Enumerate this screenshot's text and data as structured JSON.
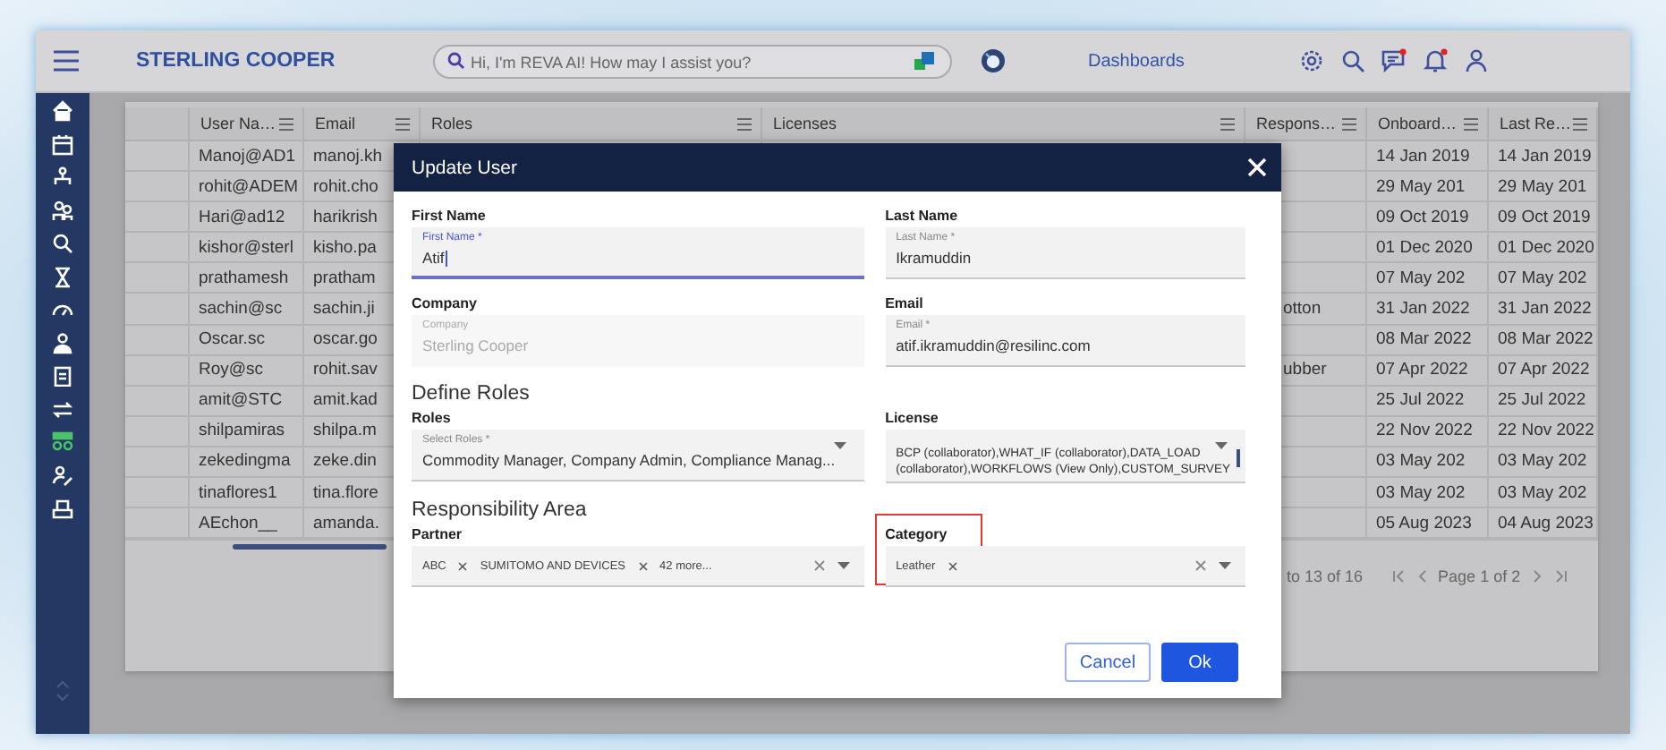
{
  "top_bar": {
    "brand": "STERLING COOPER",
    "search": {
      "placeholder": "Hi, I'm REVA AI! How may I assist you?"
    },
    "nav_link": "Dashboards",
    "icons": [
      {
        "kind": "settings",
        "badge": false
      },
      {
        "kind": "search",
        "badge": false
      },
      {
        "kind": "messages",
        "badge": true
      },
      {
        "kind": "notifications",
        "badge": true
      },
      {
        "kind": "user",
        "badge": false
      }
    ]
  },
  "sidebar": {
    "items": [
      {
        "kind": "home",
        "selected": false
      },
      {
        "kind": "calendar",
        "selected": false
      },
      {
        "kind": "hierarchy",
        "selected": false
      },
      {
        "kind": "group",
        "selected": false
      },
      {
        "kind": "search-person",
        "selected": false
      },
      {
        "kind": "hourglass",
        "selected": false
      },
      {
        "kind": "gauge",
        "selected": false
      },
      {
        "kind": "person",
        "selected": false
      },
      {
        "kind": "clipboard",
        "selected": false
      },
      {
        "kind": "transfer",
        "selected": false
      },
      {
        "kind": "network",
        "selected": true
      },
      {
        "kind": "person-edit",
        "selected": false
      },
      {
        "kind": "tray",
        "selected": false
      }
    ]
  },
  "table": {
    "columns": [
      "User Na…",
      "Email",
      "Roles",
      "Licenses",
      "Respons…",
      "Onboard…",
      "Last Re…"
    ],
    "rows": [
      {
        "user_name": "Manoj@AD1",
        "email": "manoj.kh",
        "onboarded": "14 Jan 2019",
        "last_re": "14 Jan 2019"
      },
      {
        "user_name": "rohit@ADEM",
        "email": "rohit.cho",
        "onboarded": "29 May 201",
        "last_re": "29 May 201"
      },
      {
        "user_name": "Hari@ad12",
        "email": "harikrish",
        "onboarded": "09 Oct 2019",
        "last_re": "09 Oct 2019"
      },
      {
        "user_name": "kishor@sterl",
        "email": "kisho.pa",
        "onboarded": "01 Dec 2020",
        "last_re": "01 Dec 2020"
      },
      {
        "user_name": "prathamesh",
        "email": "pratham",
        "onboarded": "07 May 202",
        "last_re": "07 May 202"
      },
      {
        "user_name": "sachin@sc",
        "email": "sachin.ji",
        "responsibility": "otton",
        "onboarded": "31 Jan 2022",
        "last_re": "31 Jan 2022"
      },
      {
        "user_name": "Oscar.sc",
        "email": "oscar.go",
        "onboarded": "08 Mar 2022",
        "last_re": "08 Mar 2022"
      },
      {
        "user_name": "Roy@sc",
        "email": "rohit.sav",
        "responsibility": "ubber",
        "onboarded": "07 Apr 2022",
        "last_re": "07 Apr 2022"
      },
      {
        "user_name": "amit@STC",
        "email": "amit.kad",
        "onboarded": "25 Jul 2022",
        "last_re": "25 Jul 2022"
      },
      {
        "user_name": "shilpamiras",
        "email": "shilpa.m",
        "onboarded": "22 Nov 2022",
        "last_re": "22 Nov 2022"
      },
      {
        "user_name": "zekedingma",
        "email": "zeke.din",
        "onboarded": "03 May 202",
        "last_re": "03 May 202"
      },
      {
        "user_name": "tinaflores1",
        "email": "tina.flore",
        "onboarded": "03 May 202",
        "last_re": "03 May 202"
      },
      {
        "user_name": "AEchon__",
        "email": "amanda.",
        "onboarded": "05 Aug 2023",
        "last_re": "04 Aug 2023"
      }
    ]
  },
  "pagination": {
    "range": "to 13 of 16",
    "page": "Page 1 of 2"
  },
  "dialog": {
    "title": "Update User",
    "fields": [
      {
        "kind": "text",
        "label": "First Name",
        "floating_label": "First Name *",
        "value": "Atif",
        "focused": true,
        "disabled": false
      },
      {
        "kind": "text",
        "label": "Last Name",
        "floating_label": "Last Name *",
        "value": "Ikramuddin",
        "focused": false,
        "disabled": false
      },
      {
        "kind": "text",
        "label": "Company",
        "floating_label": "Company",
        "value": "Sterling Cooper",
        "focused": false,
        "disabled": true
      },
      {
        "kind": "text",
        "label": "Email",
        "floating_label": "Email *",
        "value": "atif.ikramuddin@resilinc.com",
        "focused": false,
        "disabled": false
      },
      {
        "kind": "heading",
        "text": "Define Roles"
      },
      {
        "kind": "select",
        "label": "Roles",
        "floating_label": "Select Roles *",
        "value": "Commodity Manager, Company Admin, Compliance Manag..."
      },
      {
        "kind": "multiline",
        "label": "License",
        "value": "BCP (collaborator),WHAT_IF (collaborator),DATA_LOAD (collaborator),WORKFLOWS (View Only),CUSTOM_SURVEY"
      },
      {
        "kind": "heading",
        "text": "Responsibility Area"
      },
      {
        "kind": "chips",
        "label": "Partner",
        "chips": [
          "ABC",
          "SUMITOMO AND DEVICES"
        ],
        "more": "42 more...",
        "highlighted": false
      },
      {
        "kind": "chips",
        "label": "Category",
        "chips": [
          "Leather"
        ],
        "highlighted": true
      }
    ],
    "buttons": [
      {
        "label": "Cancel",
        "kind": "secondary"
      },
      {
        "label": "Ok",
        "kind": "primary"
      }
    ]
  }
}
